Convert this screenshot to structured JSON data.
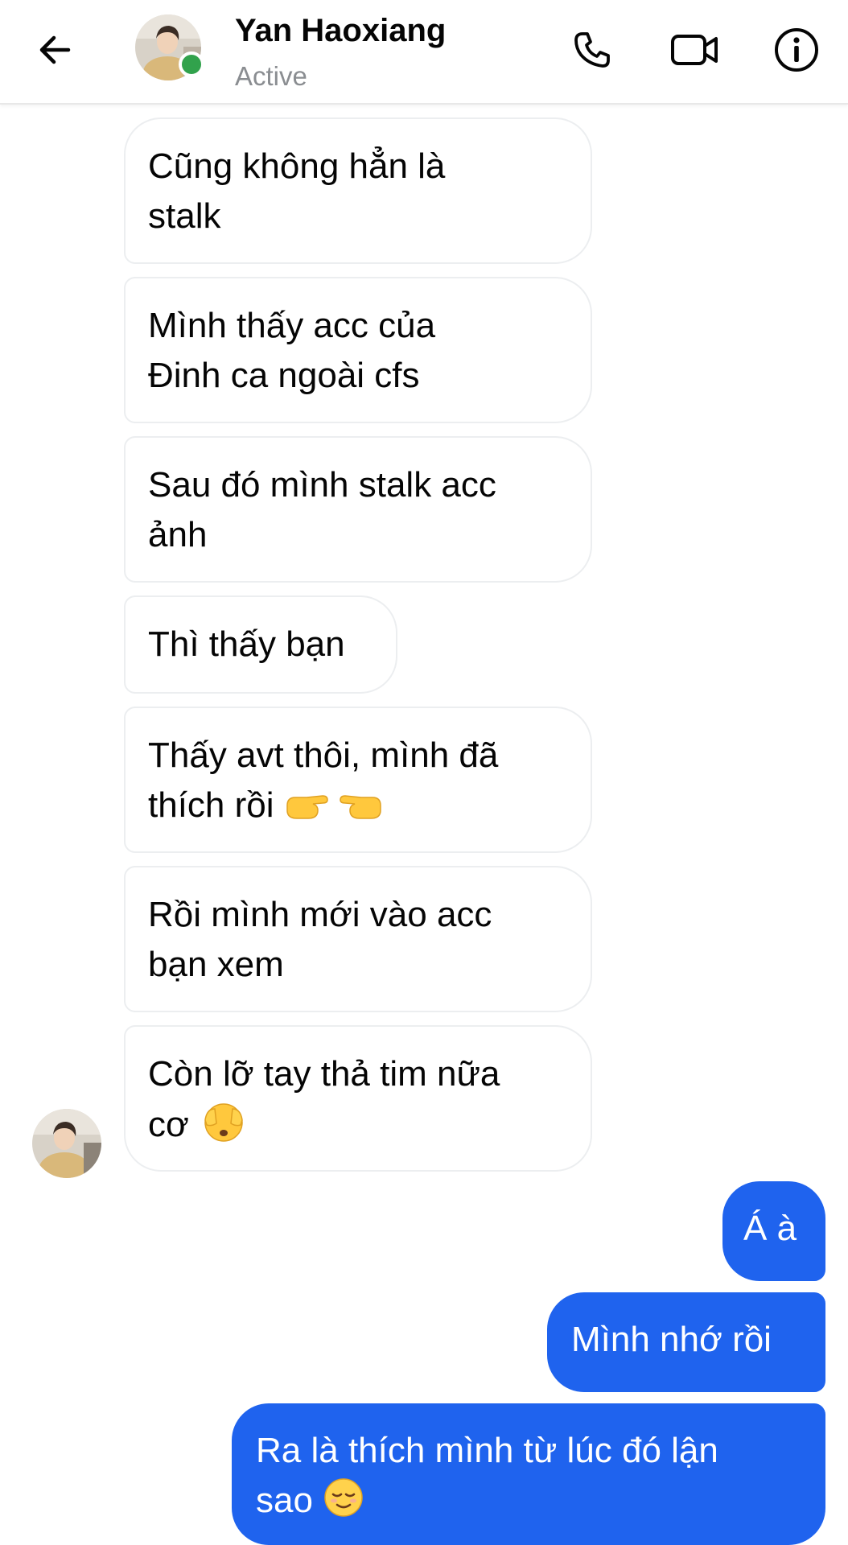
{
  "header": {
    "contact_name": "Yan Haoxiang",
    "status": "Active",
    "icons": {
      "back": "arrow-left-icon",
      "call": "phone-icon",
      "video": "video-camera-icon",
      "info": "info-icon"
    }
  },
  "messages": {
    "incoming": [
      {
        "line1": "Cũng không hẳn là",
        "line2": "stalk"
      },
      {
        "line1": "Mình thấy acc của",
        "line2": "Đinh ca ngoài cfs"
      },
      {
        "line1": "Sau đó mình stalk acc",
        "line2": "ảnh"
      },
      {
        "line1": "Thì thấy bạn"
      },
      {
        "line1": "Thấy avt thôi, mình đã",
        "line2": "thích rồi",
        "emoji": "pointing-hands-emoji"
      },
      {
        "line1": "Rồi mình mới vào acc",
        "line2": "bạn xem"
      },
      {
        "line1": "Còn lỡ tay thả tim nữa",
        "line2": "cơ",
        "emoji": "covering-eyes-emoji"
      }
    ],
    "outgoing": [
      {
        "line1": "Á à"
      },
      {
        "line1": "Mình nhớ rồi"
      },
      {
        "line1": "Ra là thích mình từ lúc đó lận",
        "line2": "sao",
        "emoji": "relieved-face-emoji"
      }
    ]
  },
  "colors": {
    "outgoing_bubble": "#1f63ee",
    "incoming_bubble_border": "#eceef0",
    "online_dot": "#31a24c",
    "status_text": "#8a8d91"
  }
}
